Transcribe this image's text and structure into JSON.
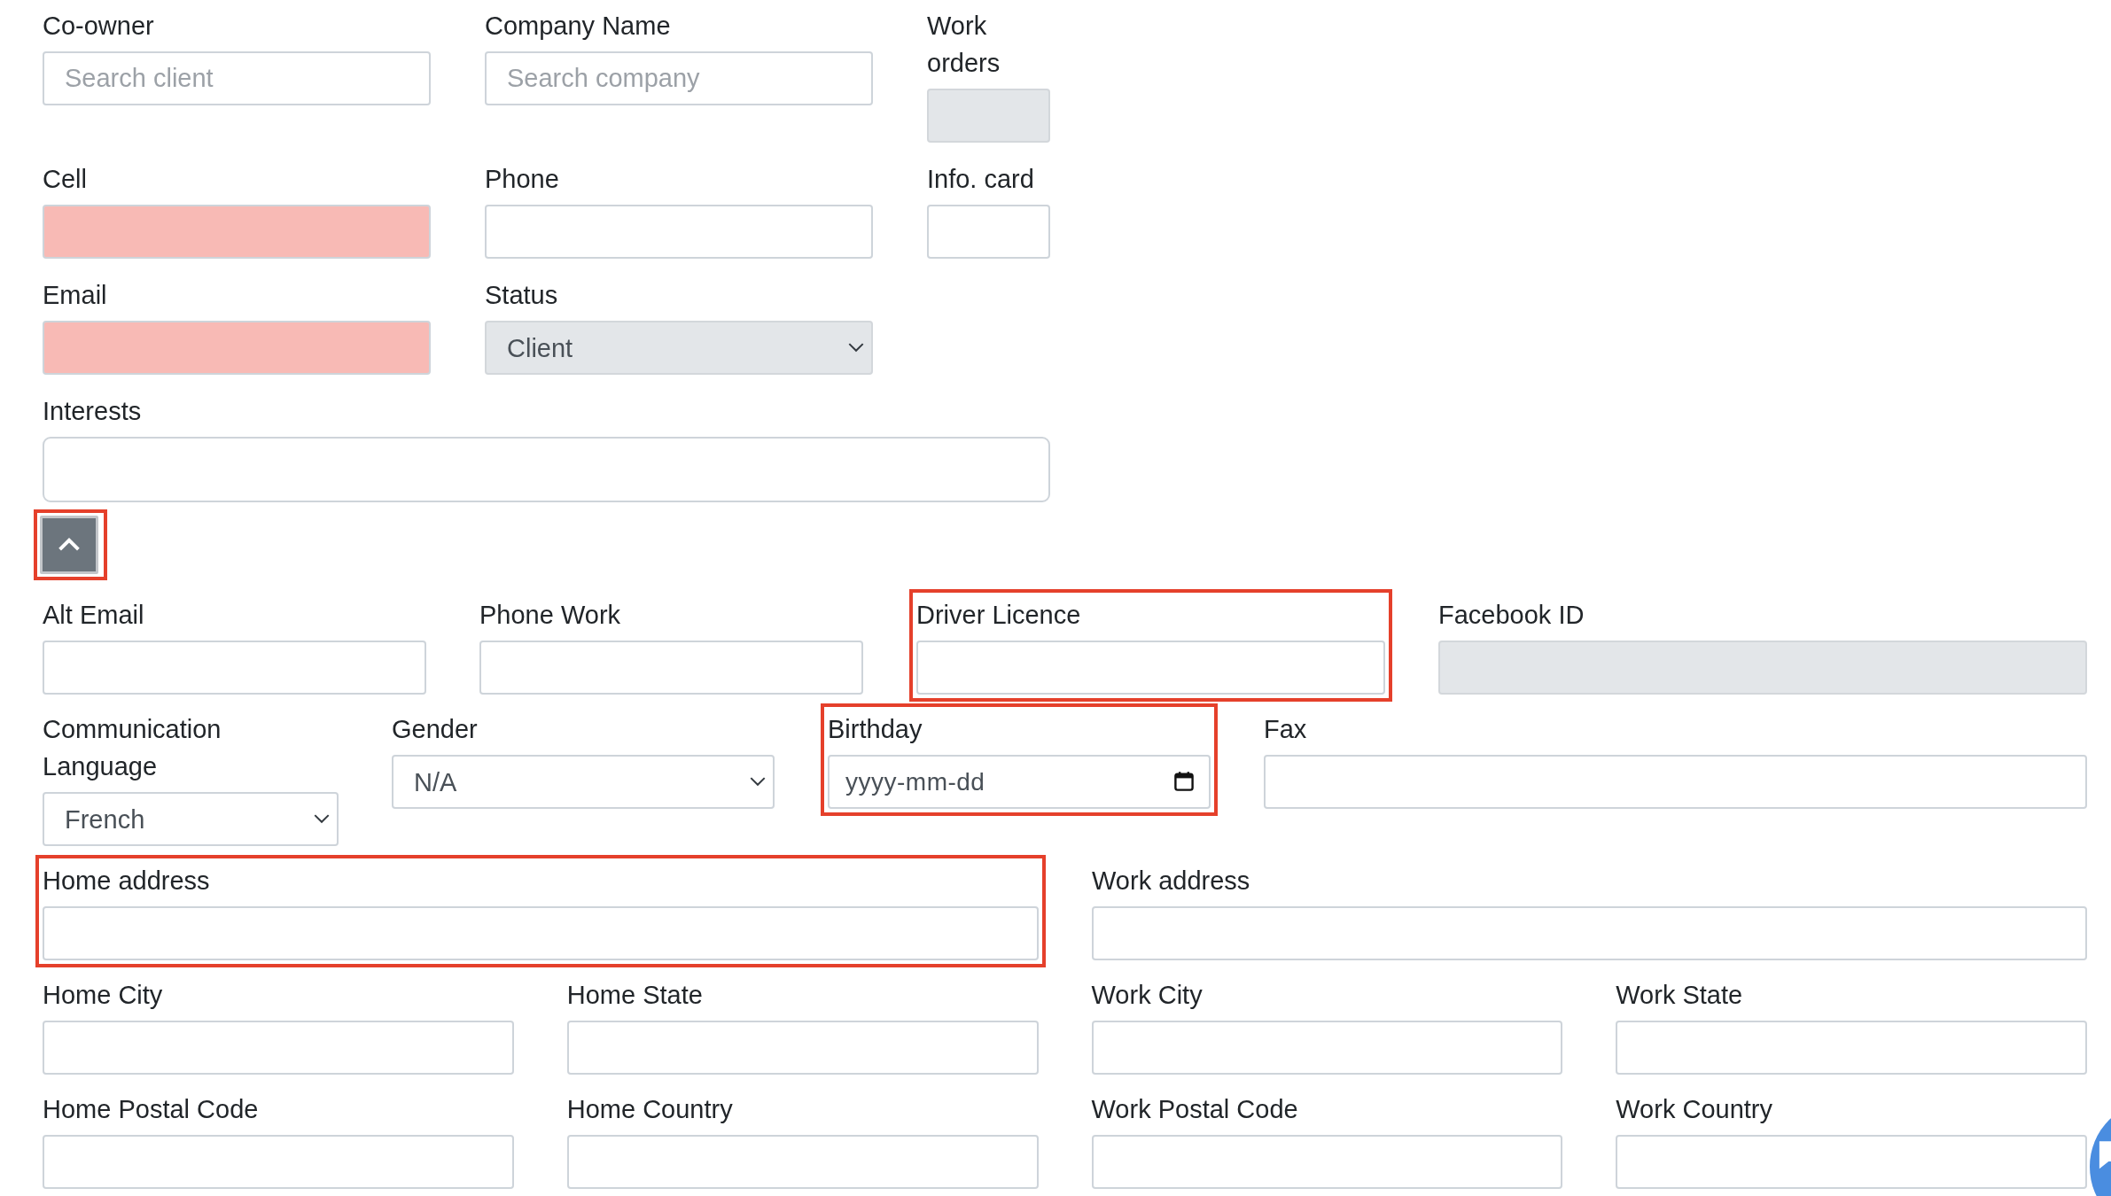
{
  "top_fields": [
    {
      "label": "Co-owner",
      "kind": "text",
      "placeholder": "Search client",
      "invalid": false,
      "disabled": false,
      "highlighted": false
    },
    {
      "label": "Company Name",
      "kind": "text",
      "placeholder": "Search company",
      "invalid": false,
      "disabled": false,
      "highlighted": false
    },
    {
      "label": "Work orders",
      "kind": "text",
      "invalid": false,
      "disabled": true,
      "highlighted": false
    },
    {
      "label": "Cell",
      "kind": "text",
      "invalid": true,
      "disabled": false,
      "highlighted": false
    },
    {
      "label": "Phone",
      "kind": "text",
      "invalid": false,
      "disabled": false,
      "highlighted": false
    },
    {
      "label": "Info. card",
      "kind": "text",
      "invalid": false,
      "disabled": false,
      "highlighted": false
    },
    {
      "label": "Email",
      "kind": "text",
      "invalid": true,
      "disabled": false,
      "highlighted": false
    },
    {
      "label": "Status",
      "kind": "select",
      "value": "Client",
      "invalid": false,
      "disabled": true,
      "highlighted": false
    },
    {
      "label": "Interests",
      "kind": "tags",
      "invalid": false,
      "disabled": false,
      "highlighted": false
    }
  ],
  "toggle": {
    "expanded": true,
    "highlighted": true
  },
  "detail_rows": [
    [
      {
        "label": "Alt Email",
        "kind": "text",
        "invalid": false,
        "disabled": false,
        "highlighted": false
      },
      {
        "label": "Phone Work",
        "kind": "text",
        "invalid": false,
        "disabled": false,
        "highlighted": false
      },
      {
        "label": "Driver Licence",
        "kind": "text",
        "invalid": false,
        "disabled": false,
        "highlighted": true
      },
      {
        "label": "Facebook ID",
        "kind": "text",
        "invalid": false,
        "disabled": true,
        "highlighted": false
      }
    ],
    [
      {
        "label": "Communication Language",
        "kind": "select",
        "value": "French",
        "invalid": false,
        "disabled": false,
        "highlighted": false
      },
      {
        "label": "Gender",
        "kind": "select",
        "value": "N/A",
        "invalid": false,
        "disabled": false,
        "highlighted": false
      },
      {
        "label": "Birthday",
        "kind": "date",
        "placeholder": "yyyy-mm-dd",
        "invalid": false,
        "disabled": false,
        "highlighted": true
      },
      {
        "label": "Fax",
        "kind": "text",
        "invalid": false,
        "disabled": false,
        "highlighted": false
      }
    ],
    [
      {
        "label": "Home address",
        "kind": "text",
        "invalid": false,
        "disabled": false,
        "highlighted": true
      },
      {
        "label": "Work address",
        "kind": "text",
        "invalid": false,
        "disabled": false,
        "highlighted": false
      }
    ],
    [
      {
        "label": "Home City",
        "kind": "text",
        "invalid": false,
        "disabled": false,
        "highlighted": false
      },
      {
        "label": "Home State",
        "kind": "text",
        "invalid": false,
        "disabled": false,
        "highlighted": false
      },
      {
        "label": "Work City",
        "kind": "text",
        "invalid": false,
        "disabled": false,
        "highlighted": false
      },
      {
        "label": "Work State",
        "kind": "text",
        "invalid": false,
        "disabled": false,
        "highlighted": false
      }
    ],
    [
      {
        "label": "Home Postal Code",
        "kind": "text",
        "invalid": false,
        "disabled": false,
        "highlighted": false
      },
      {
        "label": "Home Country",
        "kind": "text",
        "invalid": false,
        "disabled": false,
        "highlighted": false
      },
      {
        "label": "Work Postal Code",
        "kind": "text",
        "invalid": false,
        "disabled": false,
        "highlighted": false
      },
      {
        "label": "Work Country",
        "kind": "text",
        "invalid": false,
        "disabled": false,
        "highlighted": false
      }
    ]
  ]
}
